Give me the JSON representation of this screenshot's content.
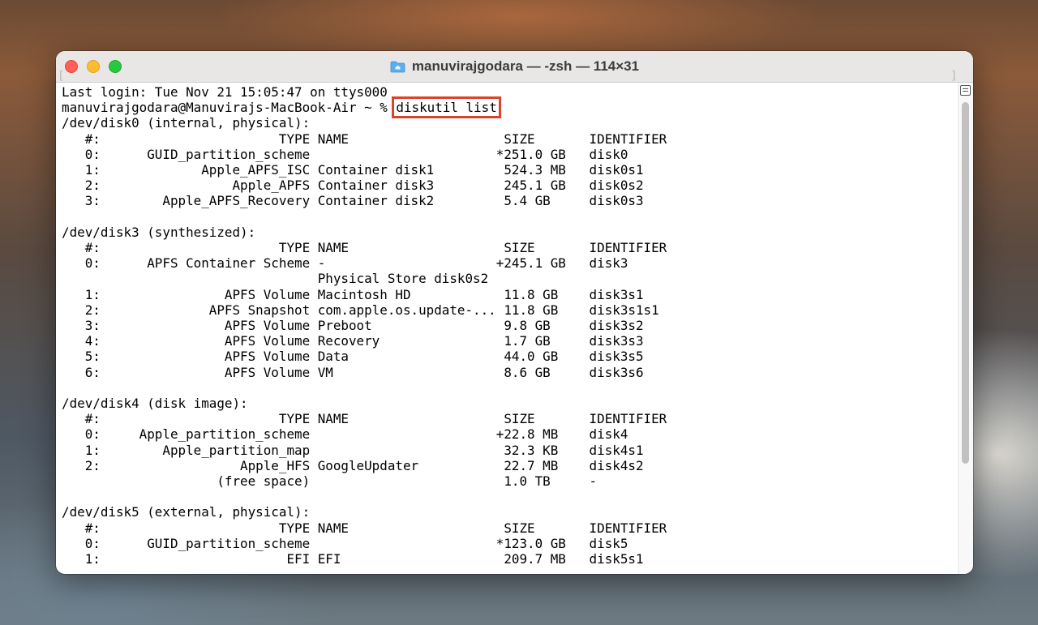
{
  "window": {
    "title": "manuvirajgodara — -zsh — 114×31",
    "colors": {
      "close": "#fe5f57",
      "minimize": "#febc2e",
      "zoom": "#28c840",
      "highlight": "#d9452b"
    }
  },
  "terminal": {
    "login_line": "Last login: Tue Nov 21 15:05:47 on ttys000",
    "prompt": "manuvirajgodara@Manuvirajs-MacBook-Air ~ % ",
    "command": "diskutil list",
    "output": "/dev/disk0 (internal, physical):\n   #:                       TYPE NAME                    SIZE       IDENTIFIER\n   0:      GUID_partition_scheme                        *251.0 GB   disk0\n   1:             Apple_APFS_ISC Container disk1         524.3 MB   disk0s1\n   2:                 Apple_APFS Container disk3         245.1 GB   disk0s2\n   3:        Apple_APFS_Recovery Container disk2         5.4 GB     disk0s3\n\n/dev/disk3 (synthesized):\n   #:                       TYPE NAME                    SIZE       IDENTIFIER\n   0:      APFS Container Scheme -                      +245.1 GB   disk3\n                                 Physical Store disk0s2\n   1:                APFS Volume Macintosh HD            11.8 GB    disk3s1\n   2:              APFS Snapshot com.apple.os.update-... 11.8 GB    disk3s1s1\n   3:                APFS Volume Preboot                 9.8 GB     disk3s2\n   4:                APFS Volume Recovery                1.7 GB     disk3s3\n   5:                APFS Volume Data                    44.0 GB    disk3s5\n   6:                APFS Volume VM                      8.6 GB     disk3s6\n\n/dev/disk4 (disk image):\n   #:                       TYPE NAME                    SIZE       IDENTIFIER\n   0:     Apple_partition_scheme                        +22.8 MB    disk4\n   1:        Apple_partition_map                         32.3 KB    disk4s1\n   2:                  Apple_HFS GoogleUpdater           22.7 MB    disk4s2\n                    (free space)                         1.0 TB     -\n\n/dev/disk5 (external, physical):\n   #:                       TYPE NAME                    SIZE       IDENTIFIER\n   0:      GUID_partition_scheme                        *123.0 GB   disk5\n   1:                        EFI EFI                     209.7 MB   disk5s1"
  }
}
